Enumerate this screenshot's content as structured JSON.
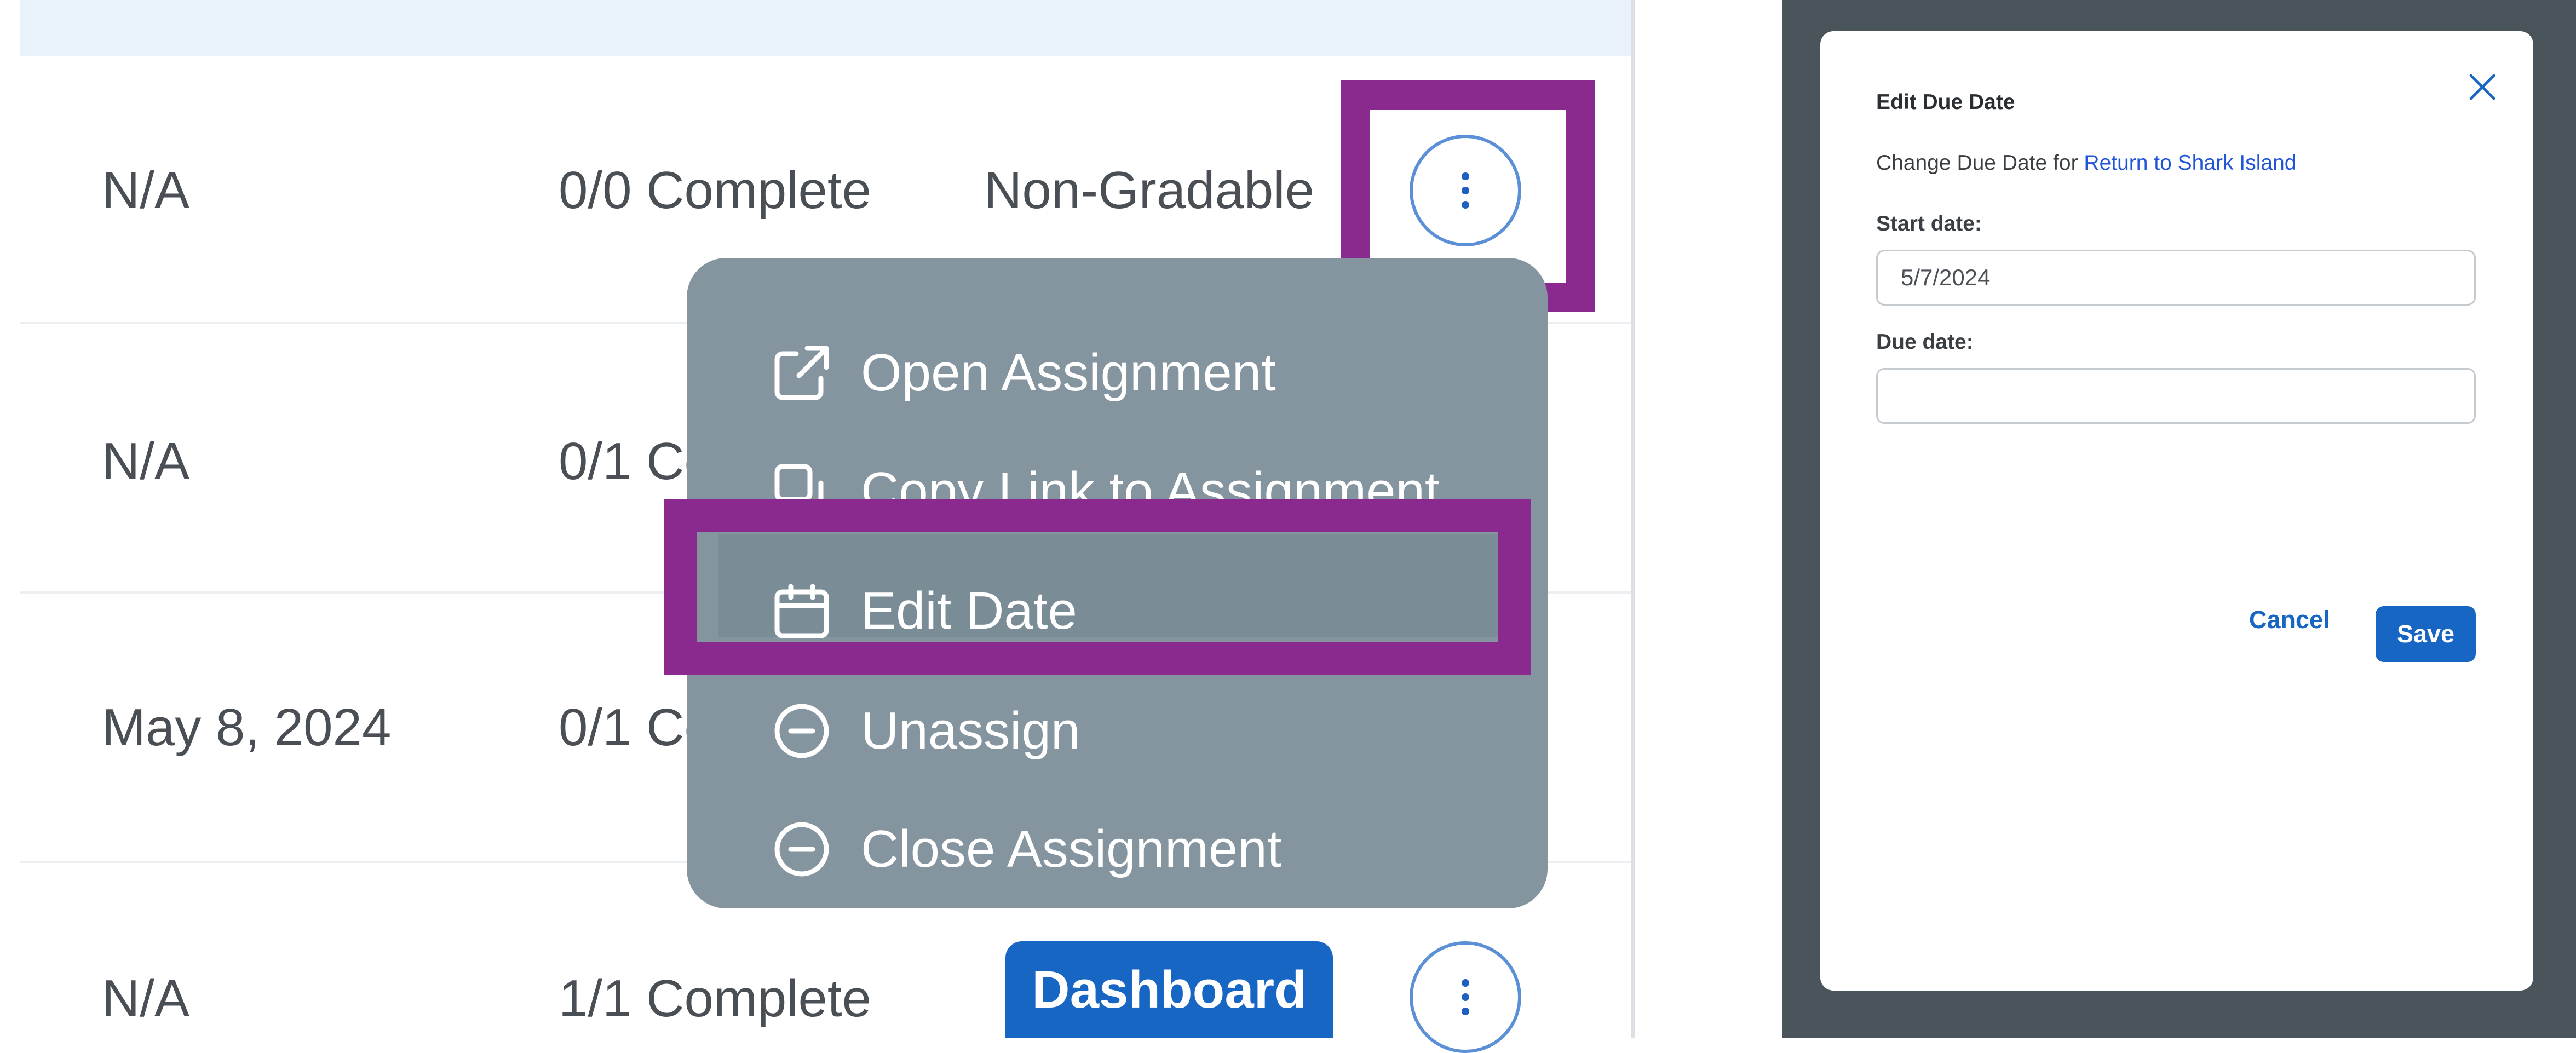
{
  "assignment_list": {
    "rows": [
      {
        "date": "N/A",
        "completion": "0/0 Complete",
        "grading": "Non-Gradable"
      },
      {
        "date": "N/A",
        "completion": "0/1 Complete"
      },
      {
        "date": "May 8, 2024",
        "completion": "0/1 Complete"
      },
      {
        "date": "N/A",
        "completion": "1/1 Complete",
        "action_label": "Dashboard"
      }
    ]
  },
  "context_menu": {
    "items": [
      {
        "label": "Open Assignment",
        "icon": "external-link-icon"
      },
      {
        "label": "Copy Link to Assignment",
        "icon": "copy-icon"
      },
      {
        "label": "Edit Date",
        "icon": "calendar-icon"
      },
      {
        "label": "Unassign",
        "icon": "minus-circle-icon"
      },
      {
        "label": "Close Assignment",
        "icon": "minus-circle-icon"
      }
    ],
    "highlighted_item": "Edit Date"
  },
  "modal": {
    "title": "Edit Due Date",
    "subtitle_prefix": "Change Due Date for",
    "assignment_link": "Return to Shark Island",
    "start_date_label": "Start date:",
    "start_date_value": "5/7/2024",
    "due_date_label": "Due date:",
    "due_date_value": "",
    "cancel_label": "Cancel",
    "save_label": "Save",
    "close_icon": "close-icon"
  },
  "colors": {
    "highlight": "#8b2a8e",
    "primary": "#1766c4",
    "menu_bg": "#84959f",
    "backdrop": "#4a545b",
    "link": "#1f55d6"
  }
}
